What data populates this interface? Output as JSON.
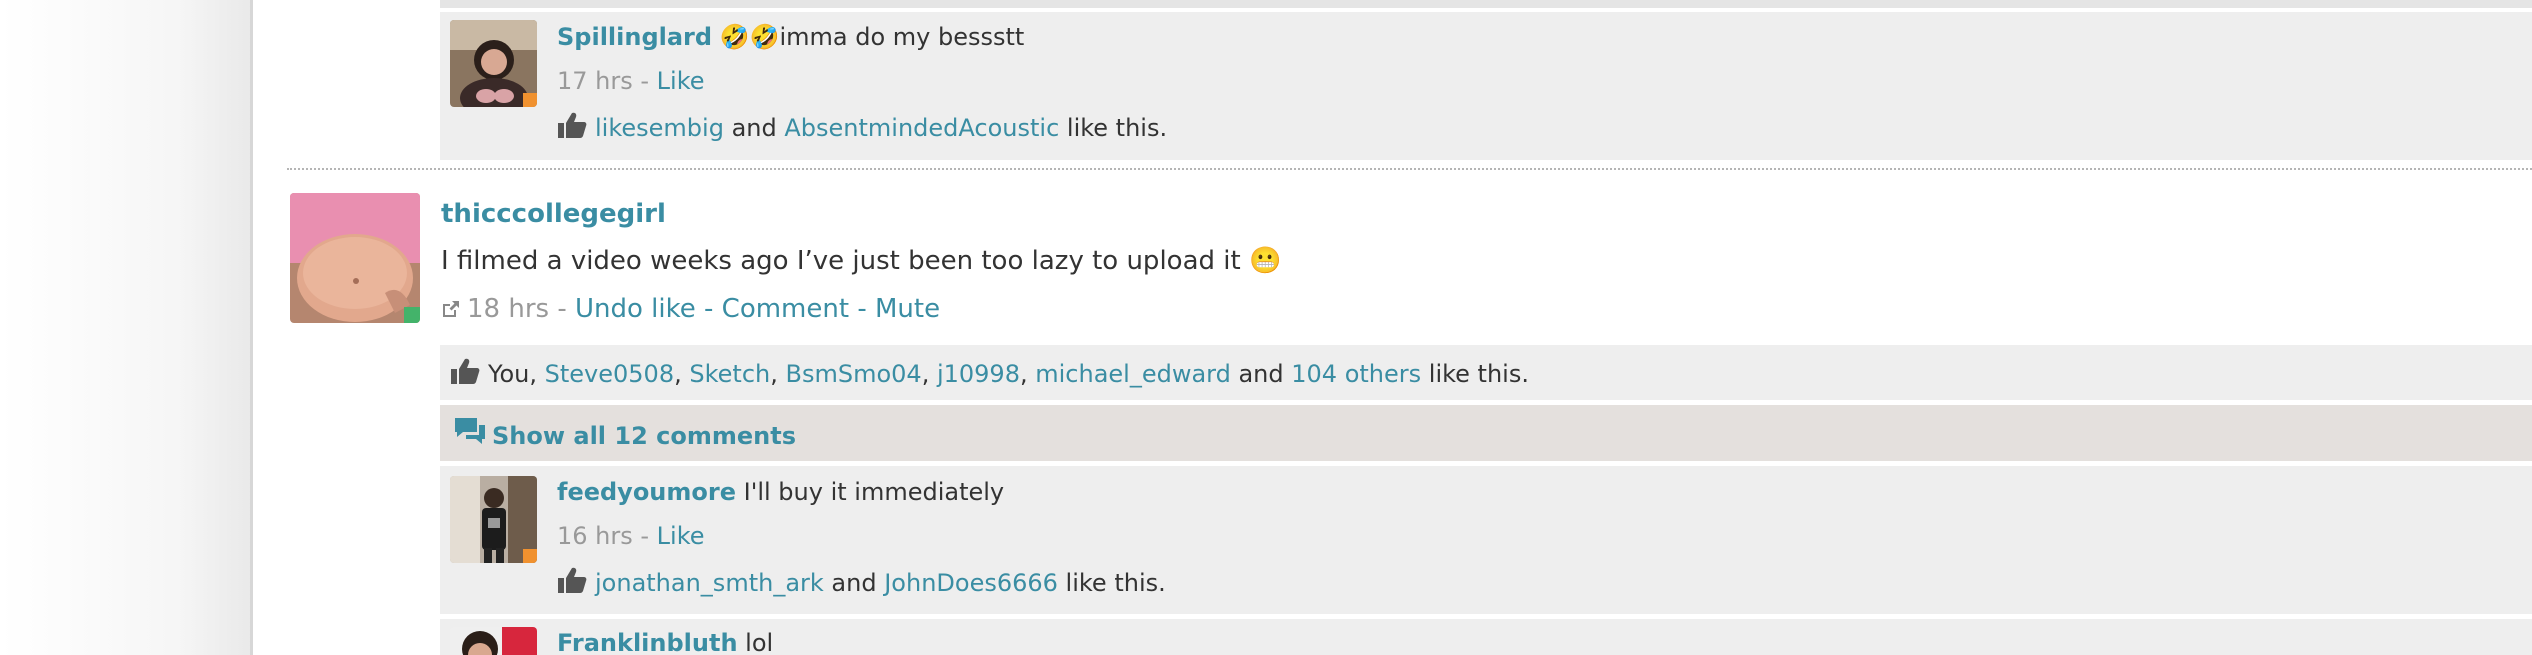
{
  "comment1": {
    "username": "Spillinglard",
    "emoji": "🤣🤣",
    "text": "imma do my bessstt",
    "time": "17 hrs",
    "sep": " - ",
    "like_label": "Like",
    "likers": [
      "likesembig",
      "AbsentmindedAcoustic"
    ],
    "and_text": " and ",
    "like_suffix": " like this."
  },
  "post": {
    "author": "thicccollegegirl",
    "body": "I filmed a video weeks ago I’ve just been too lazy to upload it 😬",
    "time": "18 hrs",
    "sep": " - ",
    "actions": [
      "Undo like",
      "Comment",
      "Mute"
    ],
    "likes": {
      "you": "You",
      "comma": ", ",
      "names": [
        "Steve0508",
        "Sketch",
        "BsmSmo04",
        "j10998",
        "michael_edward"
      ],
      "and_text": " and ",
      "others": "104 others",
      "suffix": " like this."
    },
    "show_all": "Show all 12 comments"
  },
  "comment2": {
    "username": "feedyoumore",
    "text": " I'll buy it immediately",
    "time": "16 hrs",
    "sep": " - ",
    "like_label": "Like",
    "likers": [
      "jonathan_smth_ark",
      "JohnDoes6666"
    ],
    "and_text": " and ",
    "like_suffix": " like this."
  },
  "comment3": {
    "username": "Franklinbluth",
    "text": " lol"
  },
  "colors": {
    "link": "#3a8da3",
    "muted": "#999999",
    "status_away": "#f0912f",
    "status_online": "#43b36a"
  },
  "icons": [
    "thumbs-up-icon",
    "external-link-icon",
    "comments-icon"
  ]
}
